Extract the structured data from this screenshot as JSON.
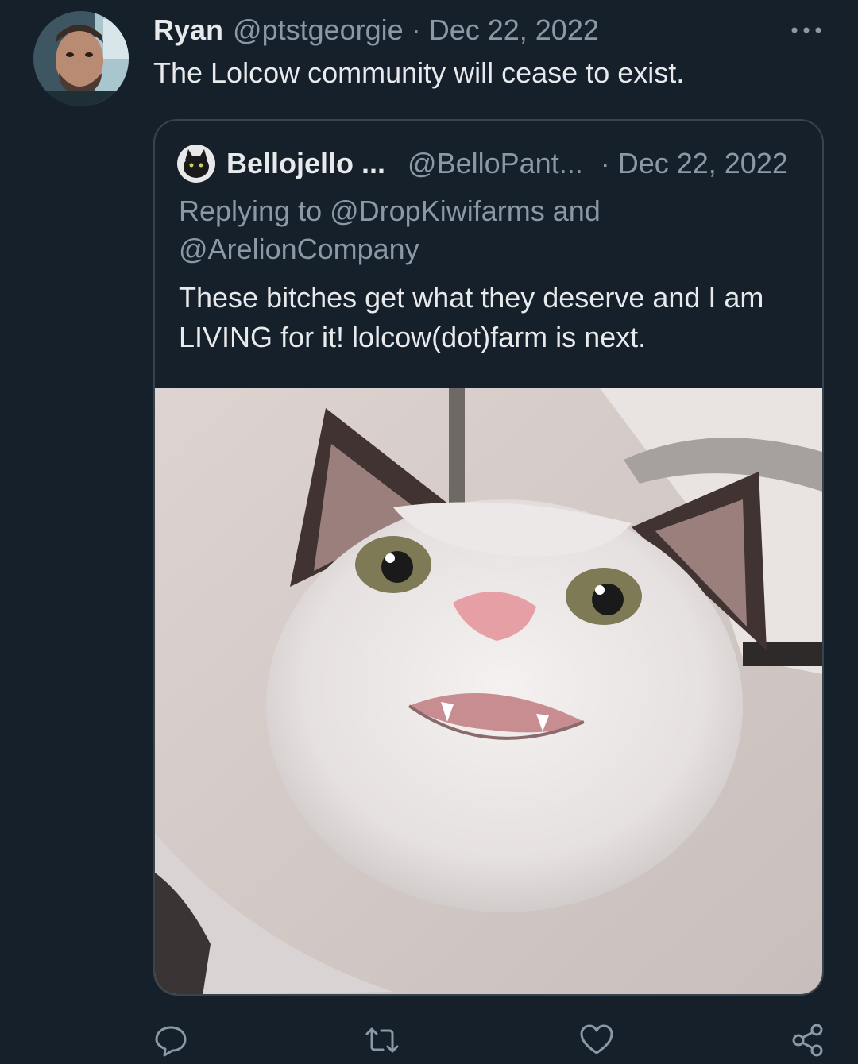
{
  "tweet": {
    "author_name": "Ryan",
    "author_handle": "@ptstgeorgie",
    "separator": "·",
    "date": "Dec 22, 2022",
    "text": "The Lolcow community will cease to exist."
  },
  "quoted_tweet": {
    "author_name": "Bellojello ...",
    "author_handle": "@BelloPant...",
    "separator": "·",
    "date": "Dec 22, 2022",
    "replying_to": "Replying to @DropKiwifarms and @ArelionCompany",
    "text": "These bitches get what they deserve and I am LIVING for it! lolcow(dot)farm is next.",
    "media_icon": "cat-photo"
  },
  "actions": [
    "reply-icon",
    "retweet-icon",
    "like-icon",
    "share-icon"
  ],
  "colors": {
    "background": "#15202b",
    "text_primary": "#e7e9ea",
    "text_secondary": "#8b98a5",
    "border": "#38444d"
  }
}
